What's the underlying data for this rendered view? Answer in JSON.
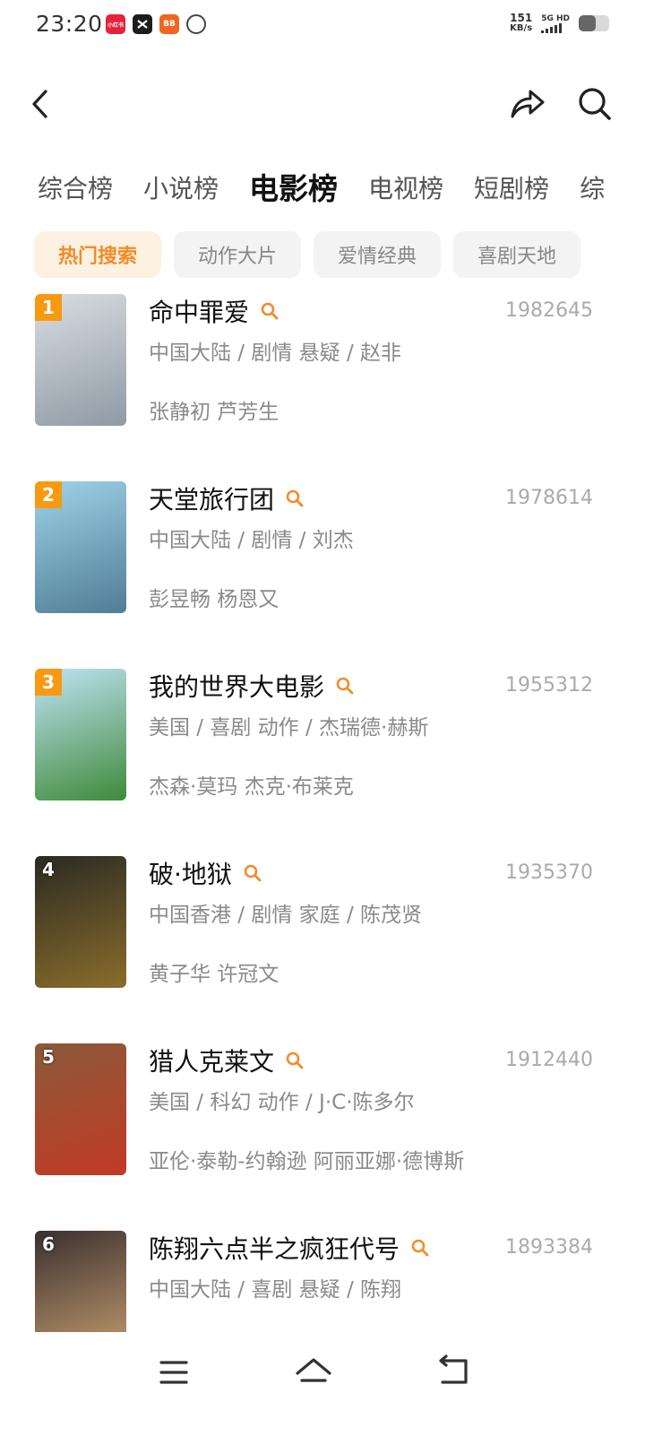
{
  "status_bar": {
    "time": "23:20",
    "net_speed_value": "151",
    "net_speed_unit": "KB/s",
    "network": "5G HD",
    "battery_level": 0.55,
    "app_icons": [
      {
        "name": "app-icon-red",
        "label": "小红书"
      },
      {
        "name": "app-icon-capcut",
        "label": ""
      },
      {
        "name": "app-icon-orange",
        "label": "BB"
      },
      {
        "name": "app-icon-ring",
        "label": ""
      }
    ]
  },
  "header": {
    "back_icon": "chevron-left-icon",
    "share_icon": "share-arrow-icon",
    "search_icon": "search-icon"
  },
  "category_tabs": [
    {
      "label": "综合榜",
      "active": false
    },
    {
      "label": "小说榜",
      "active": false
    },
    {
      "label": "电影榜",
      "active": true
    },
    {
      "label": "电视榜",
      "active": false
    },
    {
      "label": "短剧榜",
      "active": false
    },
    {
      "label": "综",
      "active": false
    }
  ],
  "filter_chips": [
    {
      "label": "热门搜索",
      "active": true
    },
    {
      "label": "动作大片",
      "active": false
    },
    {
      "label": "爱情经典",
      "active": false
    },
    {
      "label": "喜剧天地",
      "active": false
    }
  ],
  "movies": [
    {
      "rank": "1",
      "title": "命中罪爱",
      "score": "1982645",
      "meta": "中国大陆 / 剧情 悬疑 / 赵非",
      "cast": "张静初 芦芳生",
      "poster_colors": [
        "#d9dde2",
        "#8f9aa5"
      ]
    },
    {
      "rank": "2",
      "title": "天堂旅行团",
      "score": "1978614",
      "meta": "中国大陆 / 剧情 / 刘杰",
      "cast": "彭昱畅 杨恩又",
      "poster_colors": [
        "#9fd2e8",
        "#4f7d95"
      ]
    },
    {
      "rank": "3",
      "title": "我的世界大电影",
      "score": "1955312",
      "meta": "美国 / 喜剧 动作 / 杰瑞德·赫斯",
      "cast": "杰森·莫玛 杰克·布莱克",
      "poster_colors": [
        "#bfe3f5",
        "#3f8a3a"
      ]
    },
    {
      "rank": "4",
      "title": "破·地狱",
      "score": "1935370",
      "meta": "中国香港 / 剧情 家庭 / 陈茂贤",
      "cast": "黄子华 许冠文",
      "poster_colors": [
        "#2a2a22",
        "#8a6d2c"
      ]
    },
    {
      "rank": "5",
      "title": "猎人克莱文",
      "score": "1912440",
      "meta": "美国 / 科幻 动作 / J·C·陈多尔",
      "cast": "亚伦·泰勒-约翰逊 阿丽亚娜·德博斯",
      "poster_colors": [
        "#8a5a3a",
        "#c23a24"
      ]
    },
    {
      "rank": "6",
      "title": "陈翔六点半之疯狂代号",
      "score": "1893384",
      "meta": "中国大陆 / 喜剧 悬疑 / 陈翔",
      "cast": "",
      "poster_colors": [
        "#3a3030",
        "#c8a070"
      ]
    }
  ],
  "bottom_nav": {
    "menu_icon": "menu-icon",
    "home_icon": "home-icon",
    "back_icon": "back-icon"
  },
  "colors": {
    "accent": "#f28c28",
    "rank_badge": "#f79a12",
    "muted_text": "#8a8a8a",
    "chip_bg": "#f3f3f3",
    "chip_active_bg": "#fdf1e2"
  }
}
